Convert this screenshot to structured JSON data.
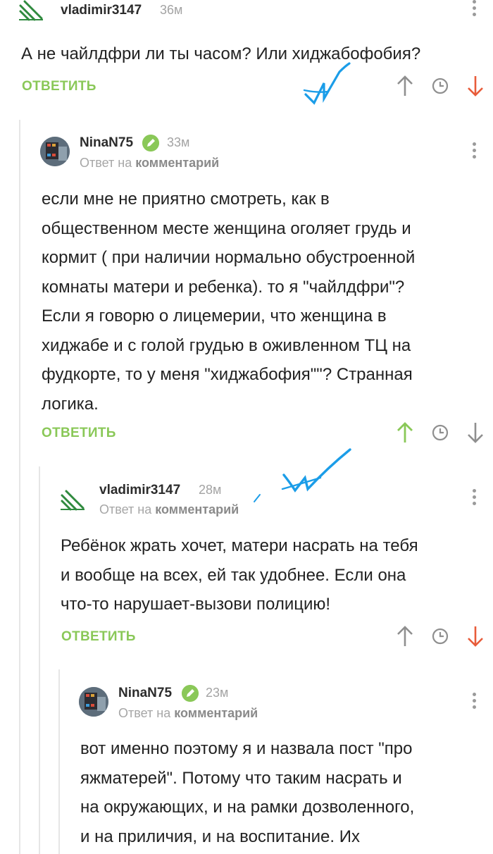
{
  "colors": {
    "accent": "#8ac858",
    "upvote_active": "#8ac858",
    "downvote_active": "#e85c3a",
    "neutral": "#9a9a9a"
  },
  "comments": [
    {
      "author": "vladimir3147",
      "time": "36м",
      "avatar": "stripes-logo-icon",
      "text": "А не чайлдфри ли ты часом? Или хиджабофобия?",
      "reply_label": "ОТВЕТИТЬ",
      "vote": "down"
    },
    {
      "author": "NinaN75",
      "time": "33м",
      "avatar": "user-photo",
      "reply_to_prefix": "Ответ на",
      "reply_to_link": "комментарий",
      "text_lines": [
        "если мне не приятно смотреть, как в",
        "общественном месте женщина оголяет грудь и",
        "кормит ( при наличии нормально обустроенной",
        "комнаты матери и ребенка). то я \"чайлдфри\"?",
        "Если я говорю о лицемерии, что женщина в",
        "хиджабе и с голой грудью в оживленном ТЦ на",
        "фудкорте, то у меня \"хиджабофия\"\"? Странная",
        "логика."
      ],
      "reply_label": "ОТВЕТИТЬ",
      "vote": "up"
    },
    {
      "author": "vladimir3147",
      "time": "28м",
      "avatar": "stripes-logo-icon",
      "reply_to_prefix": "Ответ на",
      "reply_to_link": "комментарий",
      "text_lines": [
        "Ребёнок жрать хочет, матери насрать на тебя",
        "и вообще на всех, ей так удобнее. Если она",
        "что-то нарушает-вызови полицию!"
      ],
      "reply_label": "ОТВЕТИТЬ",
      "vote": "down"
    },
    {
      "author": "NinaN75",
      "time": "23м",
      "avatar": "user-photo",
      "reply_to_prefix": "Ответ на",
      "reply_to_link": "комментарий",
      "text_lines": [
        "вот именно поэтому я и назвала пост \"про",
        "яжматерей\". Потому что таким насрать и",
        "на окружающих, и на рамки дозволенного,",
        "и на приличия, и на воспитание. Их"
      ]
    }
  ]
}
